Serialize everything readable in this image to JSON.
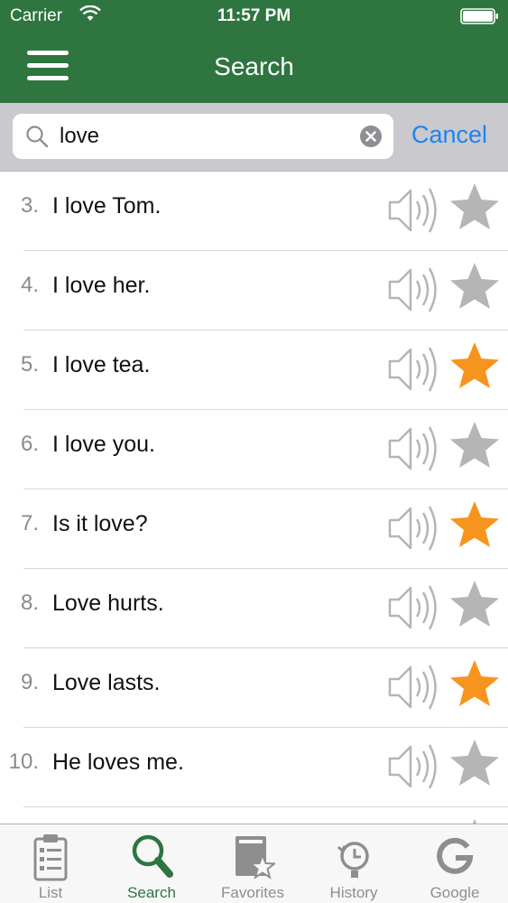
{
  "status_bar": {
    "carrier": "Carrier",
    "time": "11:57 PM"
  },
  "nav": {
    "title": "Search"
  },
  "search": {
    "value": "love",
    "cancel_label": "Cancel"
  },
  "results": [
    {
      "number": "3.",
      "text": "I love Tom.",
      "favorite": false
    },
    {
      "number": "4.",
      "text": "I love her.",
      "favorite": false
    },
    {
      "number": "5.",
      "text": "I love tea.",
      "favorite": true
    },
    {
      "number": "6.",
      "text": "I love you.",
      "favorite": false
    },
    {
      "number": "7.",
      "text": "Is it love?",
      "favorite": true
    },
    {
      "number": "8.",
      "text": "Love hurts.",
      "favorite": false
    },
    {
      "number": "9.",
      "text": "Love lasts.",
      "favorite": true
    },
    {
      "number": "10.",
      "text": "He loves me.",
      "favorite": false
    }
  ],
  "tabs": [
    {
      "label": "List",
      "icon": "clipboard-list-icon",
      "active": false
    },
    {
      "label": "Search",
      "icon": "magnifier-icon",
      "active": true
    },
    {
      "label": "Favorites",
      "icon": "book-star-icon",
      "active": false
    },
    {
      "label": "History",
      "icon": "clock-history-icon",
      "active": false
    },
    {
      "label": "Google",
      "icon": "google-g-icon",
      "active": false
    }
  ],
  "colors": {
    "brand_green": "#2e7540",
    "star_on": "#f7941d",
    "star_off": "#b5b5b5",
    "cancel_blue": "#1d84f0"
  }
}
